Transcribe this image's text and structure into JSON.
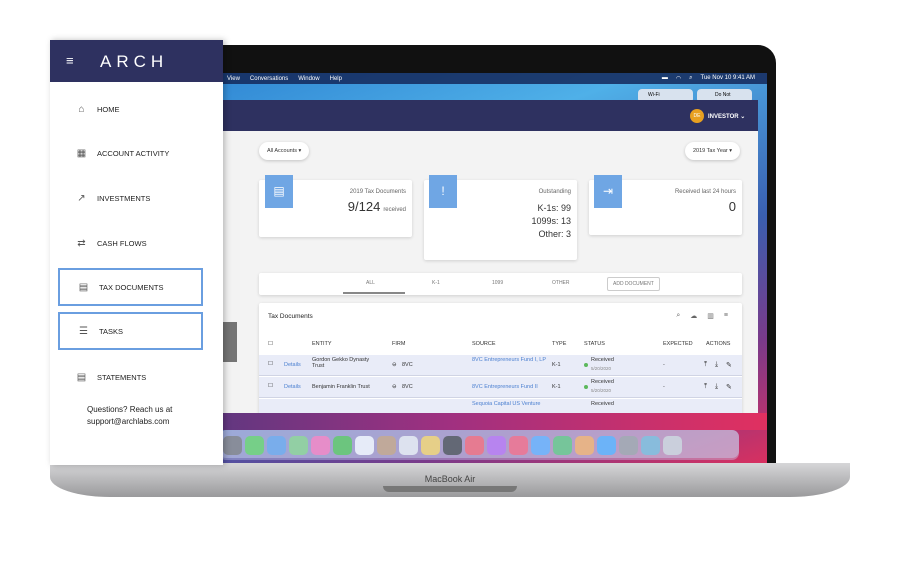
{
  "macos": {
    "menu": [
      "View",
      "Conversations",
      "Window",
      "Help"
    ],
    "clock": "Tue Nov 10  9:41 AM",
    "cc": [
      "Wi-Fi",
      "Do Not"
    ],
    "device": "MacBook Air"
  },
  "app": {
    "user_initials": "DE",
    "user_role": "INVESTOR",
    "accounts_filter": "All Accounts",
    "year_filter": "2019 Tax Year",
    "cards": [
      {
        "label": "2019 Tax Documents",
        "value": "9/124",
        "suffix": "received",
        "icon": "document-icon"
      },
      {
        "label": "Outstanding",
        "lines": [
          "K-1s: 99",
          "1099s: 13",
          "Other: 3"
        ],
        "icon": "clipboard-alert-icon"
      },
      {
        "label": "Received last 24 hours",
        "value": "0",
        "icon": "import-icon"
      }
    ],
    "tabs": [
      "ALL",
      "K-1",
      "1099",
      "OTHER"
    ],
    "active_tab": "ALL",
    "add_button": "ADD DOCUMENT",
    "table": {
      "title": "Tax Documents",
      "columns": [
        "ENTITY",
        "FIRM",
        "SOURCE",
        "TYPE",
        "STATUS",
        "EXPECTED",
        "ACTIONS"
      ],
      "rows": [
        {
          "link": "Details",
          "entity": "Gordon Gekko Dynasty Trust",
          "firm": "8VC",
          "source": "8VC Entrepreneurs Fund I, LP",
          "type": "K-1",
          "status": "Received",
          "date": "5/20/2020",
          "expected": "-"
        },
        {
          "link": "Details",
          "entity": "Benjamin Franklin Trust",
          "firm": "8VC",
          "source": "8VC Entrepreneurs Fund II",
          "type": "K-1",
          "status": "Received",
          "date": "5/20/2020",
          "expected": "-"
        },
        {
          "source": "Sequoia Capital US Venture",
          "status": "Received"
        }
      ]
    }
  },
  "sidebar": {
    "logo": "ARCH",
    "items": [
      {
        "label": "HOME",
        "icon": "home-icon"
      },
      {
        "label": "ACCOUNT ACTIVITY",
        "icon": "calendar-icon"
      },
      {
        "label": "INVESTMENTS",
        "icon": "trending-up-icon"
      },
      {
        "label": "CASH FLOWS",
        "icon": "transfer-icon"
      },
      {
        "label": "TAX DOCUMENTS",
        "icon": "clipboard-icon"
      },
      {
        "label": "TASKS",
        "icon": "checklist-icon"
      },
      {
        "label": "STATEMENTS",
        "icon": "list-icon"
      }
    ],
    "help_line1": "Questions? Reach us at",
    "help_line2": "support@archlabs.com"
  },
  "colors": {
    "navy": "#2e3160",
    "accent": "#6fa6e4",
    "status_green": "#5cb85c",
    "highlight_border": "#6a9ee0"
  }
}
